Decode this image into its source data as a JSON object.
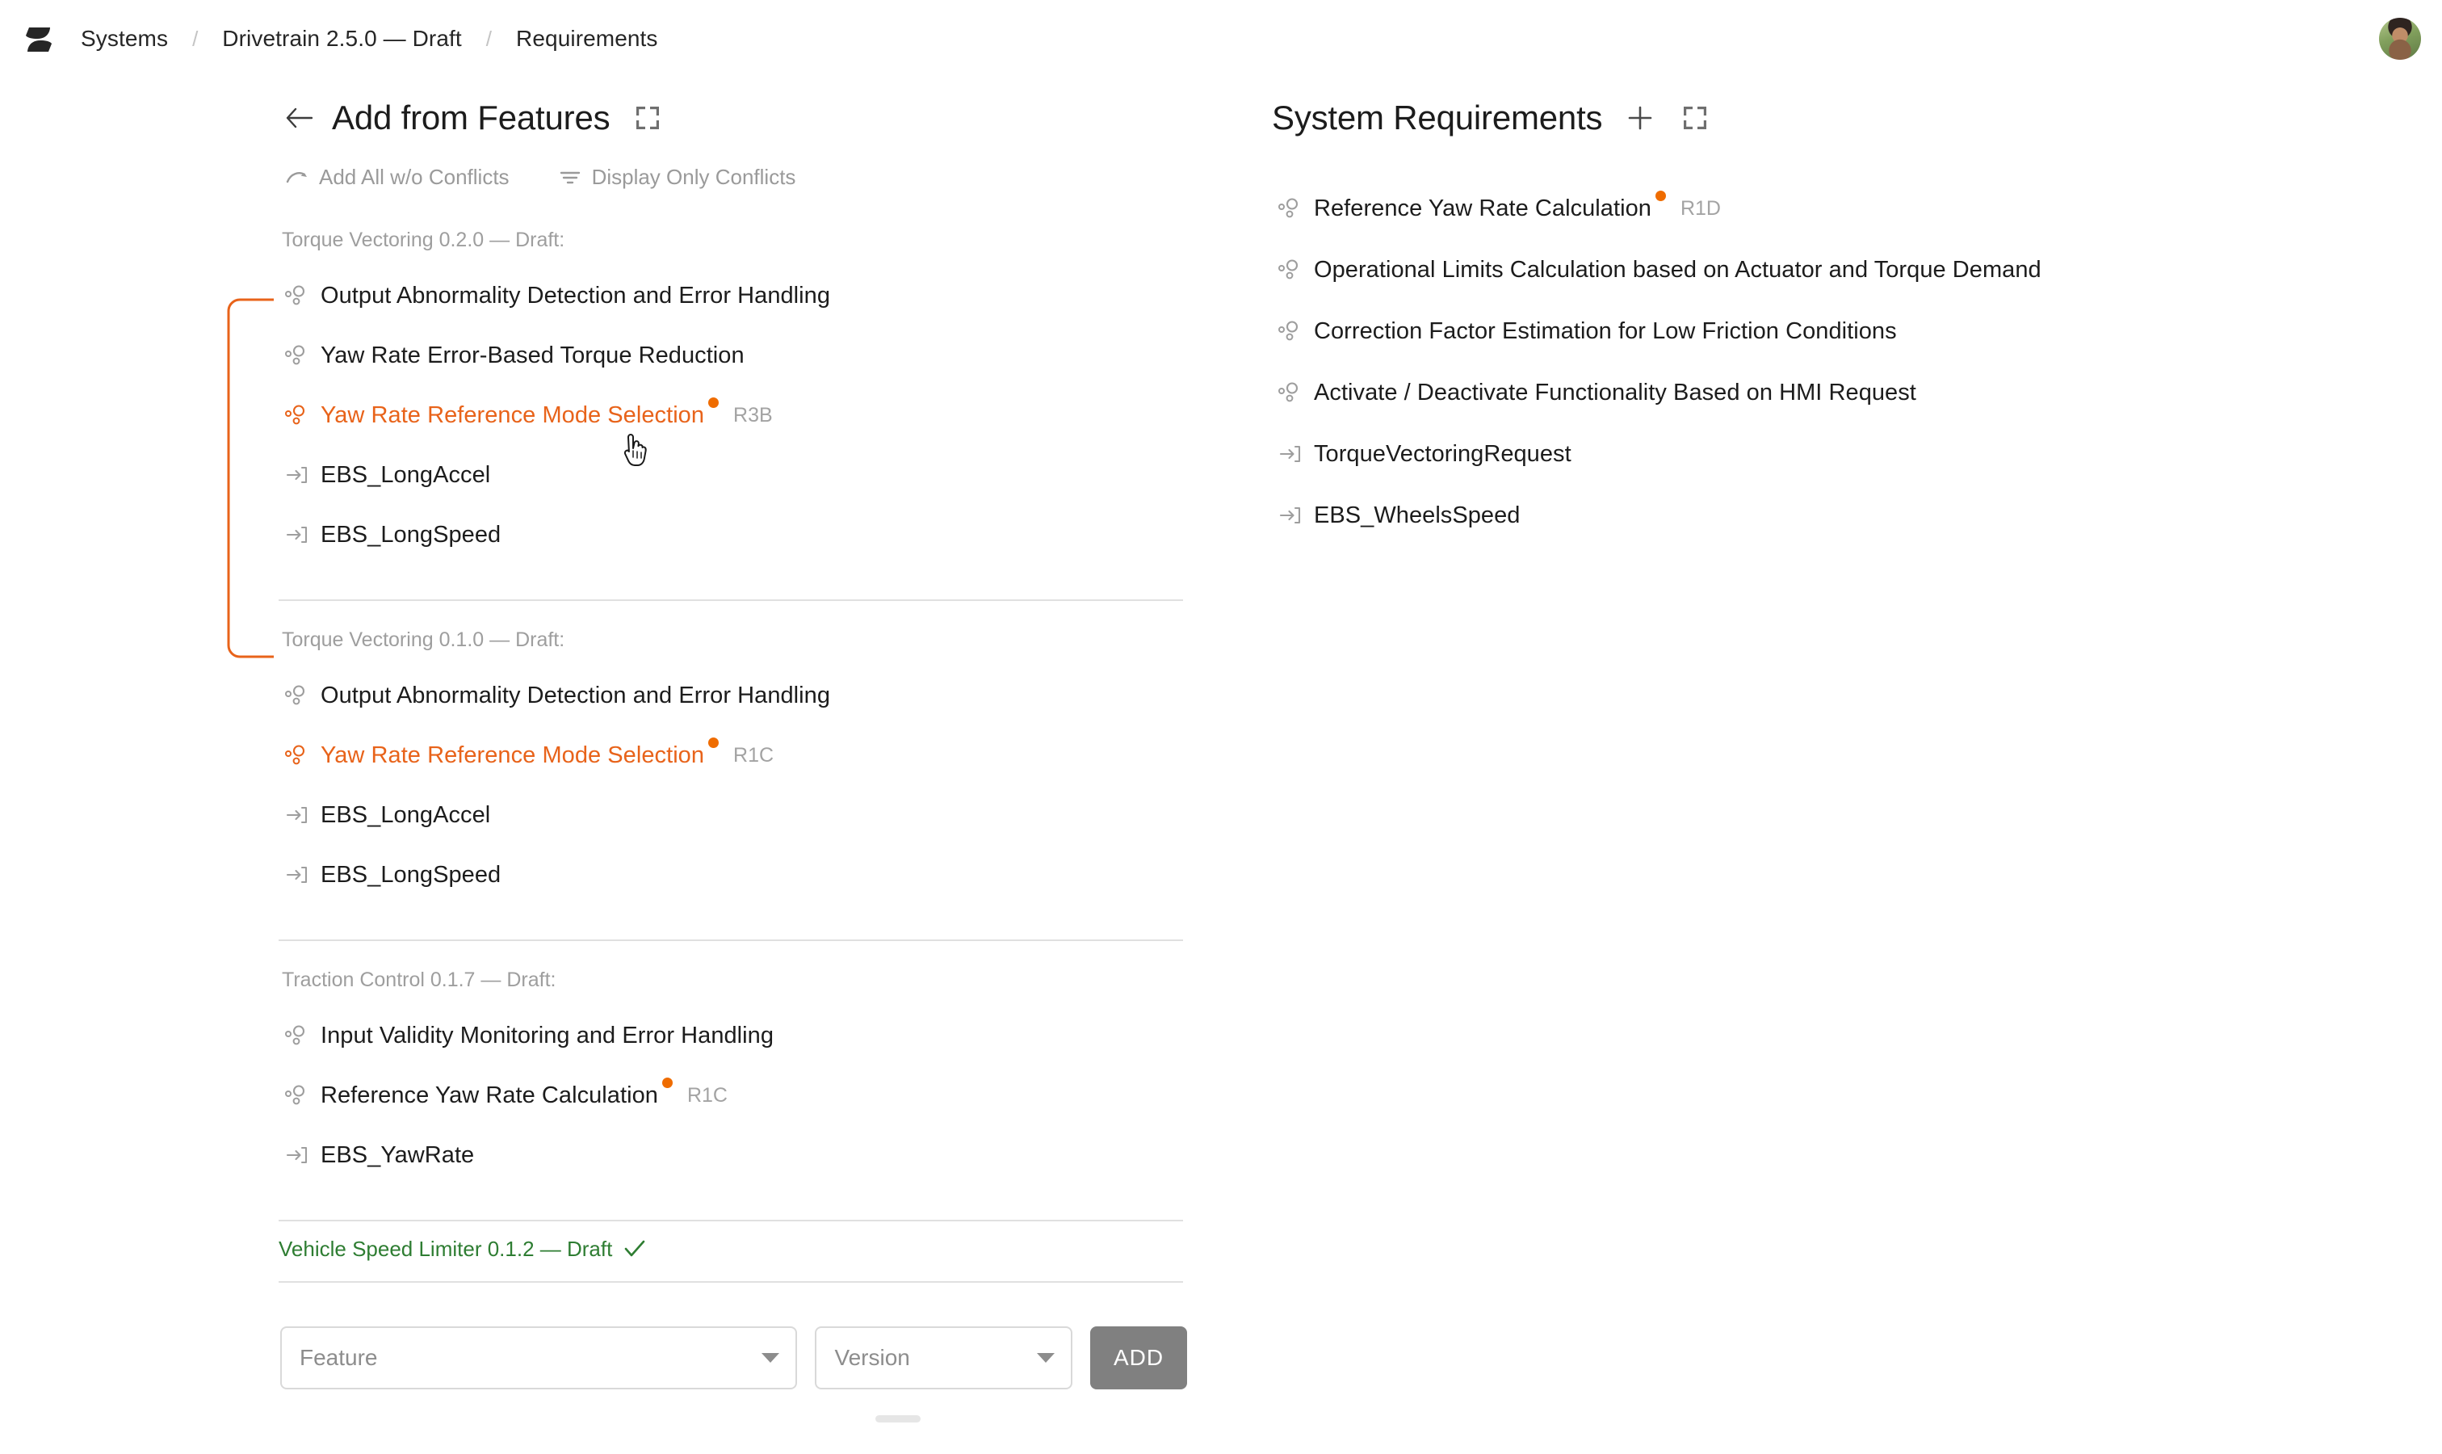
{
  "topbar": {
    "logo_icon": "slopes-logo-icon",
    "breadcrumb": [
      {
        "label": "Systems"
      },
      {
        "label": "Drivetrain 2.5.0 — Draft"
      },
      {
        "label": "Requirements"
      }
    ],
    "separator": "/",
    "avatar_icon": "user-avatar"
  },
  "left_panel": {
    "back_icon": "arrow-left-icon",
    "title": "Add from Features",
    "expand_icon": "fullscreen-icon",
    "toolbar": [
      {
        "label": "Add All w/o Conflicts",
        "icon": "redo-arrow-icon"
      },
      {
        "label": "Display Only Conflicts",
        "icon": "filter-icon"
      }
    ],
    "groups": [
      {
        "label": "Torque Vectoring 0.2.0 — Draft:",
        "status": null,
        "items": [
          {
            "type": "feature",
            "label": "Output Abnormality Detection and Error Handling",
            "conflict": false,
            "code": null
          },
          {
            "type": "feature",
            "label": "Yaw Rate Error-Based Torque Reduction",
            "conflict": false,
            "code": null
          },
          {
            "type": "feature",
            "label": "Yaw Rate Reference Mode Selection",
            "conflict": true,
            "code": "R3B"
          },
          {
            "type": "signal",
            "label": "EBS_LongAccel",
            "conflict": false,
            "code": null
          },
          {
            "type": "signal",
            "label": "EBS_LongSpeed",
            "conflict": false,
            "code": null
          }
        ]
      },
      {
        "label": "Torque Vectoring 0.1.0 — Draft:",
        "status": null,
        "items": [
          {
            "type": "feature",
            "label": "Output Abnormality Detection and Error Handling",
            "conflict": false,
            "code": null
          },
          {
            "type": "feature",
            "label": "Yaw Rate Reference Mode Selection",
            "conflict": true,
            "code": "R1C"
          },
          {
            "type": "signal",
            "label": "EBS_LongAccel",
            "conflict": false,
            "code": null
          },
          {
            "type": "signal",
            "label": "EBS_LongSpeed",
            "conflict": false,
            "code": null
          }
        ]
      },
      {
        "label": "Traction Control 0.1.7 — Draft:",
        "status": null,
        "items": [
          {
            "type": "feature",
            "label": "Input Validity Monitoring and Error Handling",
            "conflict": false,
            "code": null
          },
          {
            "type": "feature",
            "label": "Reference Yaw Rate Calculation",
            "conflict": true,
            "code": "R1C"
          },
          {
            "type": "signal",
            "label": "EBS_YawRate",
            "conflict": false,
            "code": null
          }
        ]
      },
      {
        "label": "Vehicle Speed Limiter 0.1.2 — Draft",
        "status": "ok",
        "status_icon": "check-icon",
        "items": []
      }
    ],
    "form": {
      "feature_select": {
        "value": "Feature",
        "icon": "chevron-down-icon"
      },
      "version_select": {
        "value": "Version",
        "icon": "chevron-down-icon"
      },
      "add_button": "ADD"
    }
  },
  "right_panel": {
    "title": "System Requirements",
    "add_icon": "plus-icon",
    "expand_icon": "fullscreen-icon",
    "items": [
      {
        "type": "feature",
        "label": "Reference Yaw Rate Calculation",
        "conflict": true,
        "code": "R1D"
      },
      {
        "type": "feature",
        "label": "Operational Limits Calculation based on Actuator and Torque Demand",
        "conflict": false,
        "code": null
      },
      {
        "type": "feature",
        "label": "Correction Factor Estimation for Low Friction Conditions",
        "conflict": false,
        "code": null
      },
      {
        "type": "feature",
        "label": "Activate / Deactivate Functionality Based on HMI Request",
        "conflict": false,
        "code": null
      },
      {
        "type": "signal",
        "label": "TorqueVectoringRequest",
        "conflict": false,
        "code": null
      },
      {
        "type": "signal",
        "label": "EBS_WheelsSpeed",
        "conflict": false,
        "code": null
      }
    ]
  },
  "colors": {
    "conflict_orange": "#e8631a",
    "badge_orange": "#ef6c00",
    "ok_green": "#2e7d32",
    "text": "#1c1c1c",
    "muted": "#9e9e9e",
    "divider": "#e0e0e0",
    "add_button_bg": "#808080"
  },
  "cursor": {
    "icon": "pointer-hand-cursor"
  }
}
